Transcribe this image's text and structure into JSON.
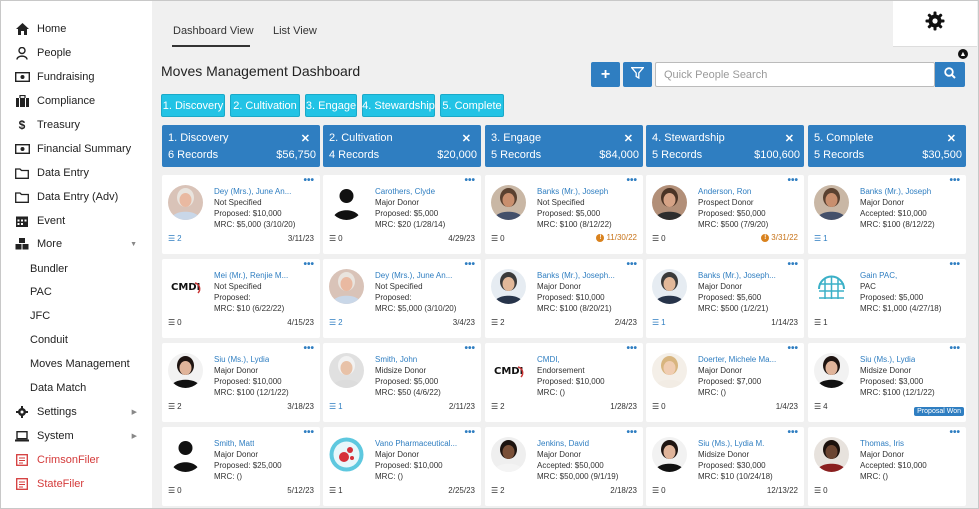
{
  "sidebar": {
    "items": [
      {
        "label": "Home",
        "icon": "home-icon"
      },
      {
        "label": "People",
        "icon": "person-icon"
      },
      {
        "label": "Fundraising",
        "icon": "money-icon"
      },
      {
        "label": "Compliance",
        "icon": "briefcase-icon"
      },
      {
        "label": "Treasury",
        "icon": "dollar-icon"
      },
      {
        "label": "Financial Summary",
        "icon": "money-icon"
      },
      {
        "label": "Data Entry",
        "icon": "folder-icon"
      },
      {
        "label": "Data Entry (Adv)",
        "icon": "folder-icon"
      },
      {
        "label": "Event",
        "icon": "calendar-icon"
      },
      {
        "label": "More",
        "icon": "cubes-icon"
      },
      {
        "label": "Bundler"
      },
      {
        "label": "PAC"
      },
      {
        "label": "JFC"
      },
      {
        "label": "Conduit"
      },
      {
        "label": "Moves Management"
      },
      {
        "label": "Data Match"
      },
      {
        "label": "Settings",
        "icon": "gear-icon"
      },
      {
        "label": "System",
        "icon": "laptop-icon"
      },
      {
        "label": "CrimsonFiler",
        "icon": "document-icon"
      },
      {
        "label": "StateFiler",
        "icon": "document-icon"
      }
    ]
  },
  "tabs": {
    "dashboard": "Dashboard View",
    "list": "List View"
  },
  "page_title": "Moves Management Dashboard",
  "search": {
    "placeholder": "Quick People Search"
  },
  "chips": [
    "1. Discovery",
    "2. Cultivation",
    "3. Engage",
    "4. Stewardship",
    "5. Complete"
  ],
  "stages": [
    {
      "name": "1. Discovery",
      "records": "6 Records",
      "amount": "$56,750"
    },
    {
      "name": "2. Cultivation",
      "records": "4 Records",
      "amount": "$20,000"
    },
    {
      "name": "3. Engage",
      "records": "5 Records",
      "amount": "$84,000"
    },
    {
      "name": "4. Stewardship",
      "records": "5 Records",
      "amount": "$100,600"
    },
    {
      "name": "5. Complete",
      "records": "5 Records",
      "amount": "$30,500"
    }
  ],
  "columns": [
    [
      {
        "name": "Dey (Mrs.), June An...",
        "type": "Not Specified",
        "proposed": "Proposed: $10,000",
        "mrc": "MRC: $5,000 (3/10/20)",
        "tasks": "2",
        "tasks_blue": true,
        "date": "3/11/23",
        "avatar": "older-woman",
        "color": "#e6b9a3"
      },
      {
        "name": "Mei (Mr.), Renjie M...",
        "type": "Not Specified",
        "proposed": "Proposed:",
        "mrc": "MRC: $10 (6/22/22)",
        "tasks": "0",
        "tasks_blue": false,
        "date": "4/15/23",
        "avatar": "cmdi-logo",
        "color": "#ffffff"
      },
      {
        "name": "Siu (Ms.), Lydia",
        "type": "Major Donor",
        "proposed": "Proposed: $10,000",
        "mrc": "MRC: $100 (12/1/22)",
        "tasks": "2",
        "tasks_blue": false,
        "date": "3/18/23",
        "avatar": "young-woman",
        "color": "#3a2a22"
      },
      {
        "name": "Smith, Matt",
        "type": "Major Donor",
        "proposed": "Proposed: $25,000",
        "mrc": "MRC: ()",
        "tasks": "0",
        "tasks_blue": false,
        "date": "5/12/23",
        "avatar": "silhouette",
        "color": "#ffffff"
      }
    ],
    [
      {
        "name": "Carothers, Clyde",
        "type": "Major Donor",
        "proposed": "Proposed: $5,000",
        "mrc": "MRC: $20 (1/28/14)",
        "tasks": "0",
        "tasks_blue": false,
        "date": "4/29/23",
        "avatar": "silhouette",
        "color": "#ffffff"
      },
      {
        "name": "Dey (Mrs.), June An...",
        "type": "Not Specified",
        "proposed": "Proposed:",
        "mrc": "MRC: $5,000 (3/10/20)",
        "tasks": "2",
        "tasks_blue": true,
        "date": "3/4/23",
        "avatar": "older-woman",
        "color": "#e6b9a3"
      },
      {
        "name": "Smith, John",
        "type": "Midsize Donor",
        "proposed": "Proposed: $5,000",
        "mrc": "MRC: $50 (4/6/22)",
        "tasks": "1",
        "tasks_blue": true,
        "date": "2/11/23",
        "avatar": "older-man",
        "color": "#d8d8d8"
      },
      {
        "name": "Vano Pharmaceutical...",
        "type": "Major Donor",
        "proposed": "Proposed: $10,000",
        "mrc": "MRC: ()",
        "tasks": "1",
        "tasks_blue": false,
        "date": "2/25/23",
        "avatar": "pharma-logo",
        "color": "#5ec8df"
      }
    ],
    [
      {
        "name": "Banks (Mr.), Joseph",
        "type": "Not Specified",
        "proposed": "Proposed: $5,000",
        "mrc": "MRC: $100 (8/12/22)",
        "tasks": "0",
        "tasks_blue": false,
        "date": "11/30/22",
        "alert": true,
        "avatar": "bearded-man",
        "color": "#a57b62"
      },
      {
        "name": "Banks (Mr.), Joseph...",
        "type": "Major Donor",
        "proposed": "Proposed: $10,000",
        "mrc": "MRC: $100 (8/20/21)",
        "tasks": "2",
        "tasks_blue": false,
        "date": "2/4/23",
        "avatar": "suited-man",
        "color": "#cfd8e0"
      },
      {
        "name": "CMDI,",
        "type": "Endorsement",
        "proposed": "Proposed: $10,000",
        "mrc": "MRC: ()",
        "tasks": "2",
        "tasks_blue": false,
        "date": "1/28/23",
        "avatar": "cmdi-logo",
        "color": "#ffffff"
      },
      {
        "name": "Jenkins, David",
        "type": "Major Donor",
        "proposed": "Accepted: $50,000",
        "mrc": "MRC: $50,000 (9/1/19)",
        "tasks": "2",
        "tasks_blue": false,
        "date": "2/18/23",
        "avatar": "smiling-man",
        "color": "#6b4a35"
      }
    ],
    [
      {
        "name": "Anderson, Ron",
        "type": "Prospect Donor",
        "proposed": "Proposed: $50,000",
        "mrc": "MRC: $500 (7/9/20)",
        "tasks": "0",
        "tasks_blue": false,
        "date": "3/31/22",
        "alert": true,
        "avatar": "man-glasses",
        "color": "#9a6e55"
      },
      {
        "name": "Banks (Mr.), Joseph...",
        "type": "Major Donor",
        "proposed": "Proposed: $5,600",
        "mrc": "MRC: $500 (1/2/21)",
        "tasks": "1",
        "tasks_blue": true,
        "date": "1/14/23",
        "avatar": "suited-man",
        "color": "#ffffff"
      },
      {
        "name": "Doerter, Michele Ma...",
        "type": "Major Donor",
        "proposed": "Proposed: $7,000",
        "mrc": "MRC: ()",
        "tasks": "0",
        "tasks_blue": false,
        "date": "1/4/23",
        "avatar": "blonde-woman",
        "color": "#e9cba8"
      },
      {
        "name": "Siu (Ms.), Lydia M.",
        "type": "Midsize Donor",
        "proposed": "Proposed: $30,000",
        "mrc": "MRC: $10 (10/24/18)",
        "tasks": "0",
        "tasks_blue": false,
        "date": "12/13/22",
        "avatar": "young-woman",
        "color": "#3a2a22"
      }
    ],
    [
      {
        "name": "Banks (Mr.), Joseph",
        "type": "Major Donor",
        "proposed": "Accepted: $10,000",
        "mrc": "MRC: $100 (8/12/22)",
        "tasks": "1",
        "tasks_blue": true,
        "date": "",
        "avatar": "bearded-man",
        "color": "#a57b62"
      },
      {
        "name": "Gain PAC,",
        "type": "PAC",
        "proposed": "Proposed: $5,000",
        "mrc": "MRC: $1,000 (4/27/18)",
        "tasks": "1",
        "tasks_blue": false,
        "date": "",
        "avatar": "globe-logo",
        "color": "#ffffff"
      },
      {
        "name": "Siu (Ms.), Lydia",
        "type": "Midsize Donor",
        "proposed": "Proposed: $3,000",
        "mrc": "MRC: $100 (12/1/22)",
        "tasks": "4",
        "tasks_blue": false,
        "date": "",
        "badge": "Proposal Won",
        "avatar": "young-woman",
        "color": "#3a2a22"
      },
      {
        "name": "Thomas, Iris",
        "type": "Major Donor",
        "proposed": "Accepted: $10,000",
        "mrc": "MRC: ()",
        "tasks": "0",
        "tasks_blue": false,
        "date": "",
        "avatar": "curly-woman",
        "color": "#2a1c16"
      }
    ]
  ],
  "colors": {
    "primary": "#2f7ec1",
    "chip": "#22c3e5",
    "alert": "#d9821e",
    "danger": "#d43a3a"
  }
}
